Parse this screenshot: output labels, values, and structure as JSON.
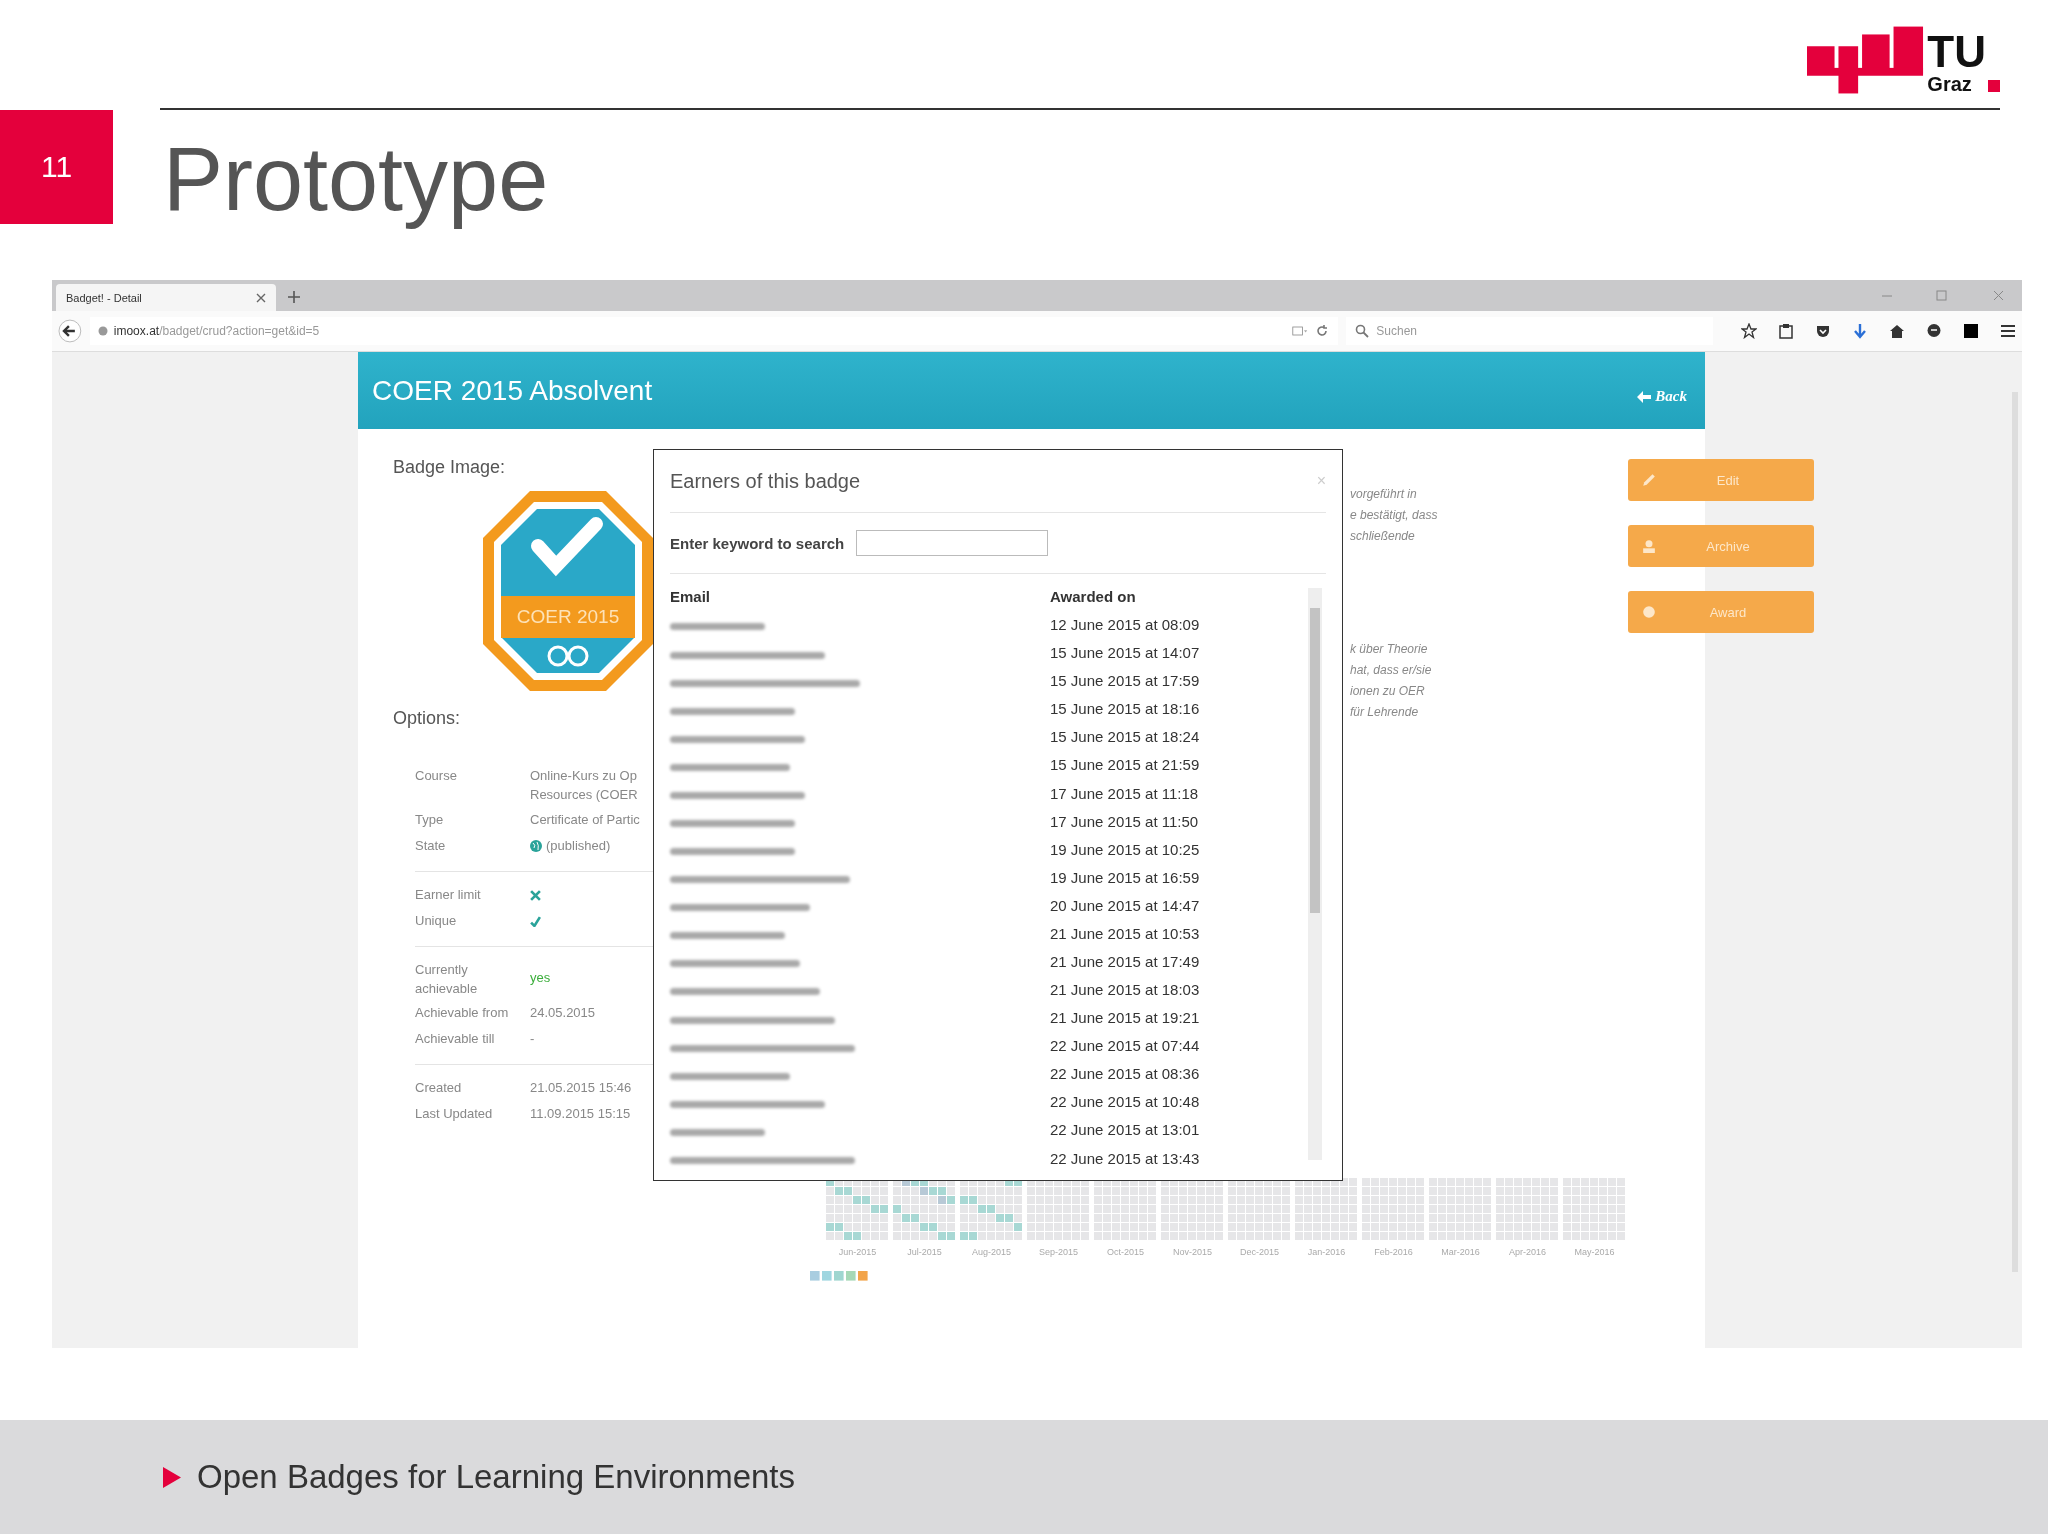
{
  "slide": {
    "number": "11",
    "title": "Prototype",
    "logo": {
      "word": "TU",
      "sub": "Graz"
    },
    "footer": "Open Badges for Learning Environments"
  },
  "browser": {
    "tab": "Badget! - Detail",
    "url_domain": "imoox.at",
    "url_path": "/badget/crud?action=get&id=5",
    "search_placeholder": "Suchen"
  },
  "page": {
    "title": "COER 2015 Absolvent",
    "back": "Back",
    "badge_label": "Badge Image:",
    "badge_text": "COER 2015",
    "options_label": "Options:",
    "option_groups": [
      [
        {
          "label": "Course",
          "value": "Online-Kurs zu Op",
          "value2": "Resources (COER",
          "kind": "text"
        },
        {
          "label": "Type",
          "value": "Certificate of Partic",
          "kind": "text"
        },
        {
          "label": "State",
          "value": "(published)",
          "kind": "globe"
        }
      ],
      [
        {
          "label": "Earner limit",
          "kind": "cross"
        },
        {
          "label": "Unique",
          "kind": "tick"
        }
      ],
      [
        {
          "label": "Currently achievable",
          "value": "yes",
          "kind": "yes"
        },
        {
          "label": "Achievable from",
          "value": "24.05.2015",
          "kind": "text"
        },
        {
          "label": "Achievable till",
          "value": "-",
          "kind": "text"
        }
      ],
      [
        {
          "label": "Created",
          "value": "21.05.2015 15:46",
          "kind": "text"
        },
        {
          "label": "Last Updated",
          "value": "11.09.2015 15:15",
          "kind": "text"
        }
      ]
    ],
    "description_1": [
      "vorgeführt in",
      "e bestätigt, dass",
      "schließende"
    ],
    "description_2": [
      "k über Theorie",
      "hat, dass er/sie",
      "ionen zu OER",
      "für Lehrende"
    ],
    "buttons": [
      {
        "label": "Edit",
        "kind": "edit"
      },
      {
        "label": "Archive",
        "kind": "archive"
      },
      {
        "label": "Award",
        "kind": "award"
      }
    ],
    "months": [
      "Jun-2015",
      "Jul-2015",
      "Aug-2015",
      "Sep-2015",
      "Oct-2015",
      "Nov-2015",
      "Dec-2015",
      "Jan-2016",
      "Feb-2016",
      "Mar-2016",
      "Apr-2016",
      "May-2016"
    ]
  },
  "modal": {
    "title": "Earners of this badge",
    "close": "×",
    "search_label": "Enter keyword to search",
    "columns": [
      "Email",
      "Awarded on"
    ],
    "rows": [
      "12 June 2015 at 08:09",
      "15 June 2015 at 14:07",
      "15 June 2015 at 17:59",
      "15 June 2015 at 18:16",
      "15 June 2015 at 18:24",
      "15 June 2015 at 21:59",
      "17 June 2015 at 11:18",
      "17 June 2015 at 11:50",
      "19 June 2015 at 10:25",
      "19 June 2015 at 16:59",
      "20 June 2015 at 14:47",
      "21 June 2015 at 10:53",
      "21 June 2015 at 17:49",
      "21 June 2015 at 18:03",
      "21 June 2015 at 19:21",
      "22 June 2015 at 07:44",
      "22 June 2015 at 08:36",
      "22 June 2015 at 10:48",
      "22 June 2015 at 13:01",
      "22 June 2015 at 13:43"
    ]
  }
}
